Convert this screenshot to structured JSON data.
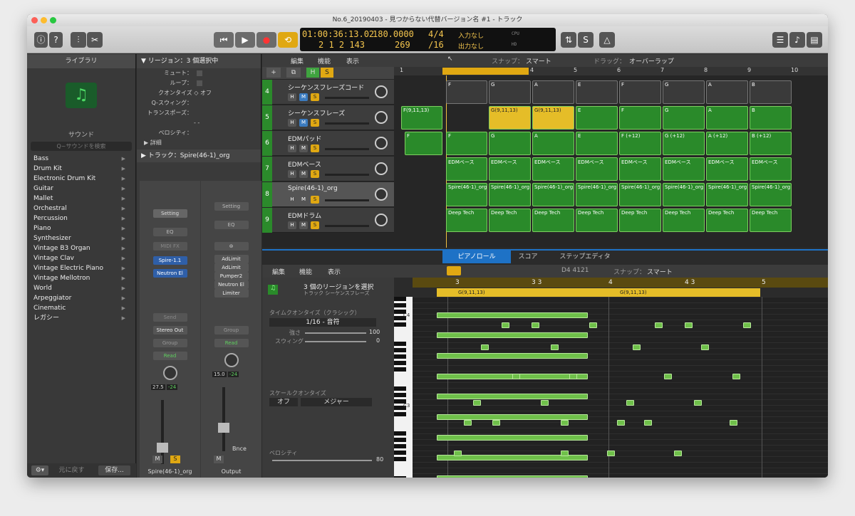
{
  "window": {
    "title": "No.6_20190403 - 見つからない代替バージョン名 #1 - トラック"
  },
  "lcd": {
    "time": "01:00:36:13.02",
    "bars": "2 1 2 143",
    "tempo": "180.0000",
    "tempo2": "269",
    "sig": "4/4",
    "div": "/16",
    "in": "入力なし",
    "out": "出力なし",
    "cpu": "CPU",
    "hd": "HD"
  },
  "library": {
    "header": "ライブラリ",
    "sound_label": "サウンド",
    "search_placeholder": "Q~サウンドを検索",
    "items": [
      "Bass",
      "Drum Kit",
      "Electronic Drum Kit",
      "Guitar",
      "Mallet",
      "Orchestral",
      "Percussion",
      "Piano",
      "Synthesizer",
      "Vintage B3 Organ",
      "Vintage Clav",
      "Vintage Electric Piano",
      "Vintage Mellotron",
      "World",
      "Arpeggiator",
      "Cinematic",
      "レガシー"
    ],
    "revert": "元に戻す",
    "save": "保存..."
  },
  "inspector": {
    "region_header": "▼ リージョン：3 個選択中",
    "mute": "ミュート：",
    "loop": "ループ：",
    "quantize": "クオンタイズ ◇ オフ",
    "qswing": "Q-スウィング：",
    "transpose": "トランスポーズ：",
    "velocity": "ベロシティ：",
    "dash": "- -",
    "detail": "▶ 詳細",
    "track_header": "▶ トラック：Spire(46-1)_org"
  },
  "strip1": {
    "setting": "Setting",
    "eq": "EQ",
    "midifx": "MIDI FX",
    "inst": "Spire-1.1",
    "fx1": "Neutron El",
    "send": "Send",
    "stereo": "Stereo Out",
    "group": "Group",
    "read": "Read",
    "val1": "27.5",
    "val2": "-24",
    "m": "M",
    "s": "S",
    "name": "Spire(46-1)_org"
  },
  "strip2": {
    "setting": "Setting",
    "eq": "EQ",
    "fx": [
      "AdLimit",
      "AdLimit",
      "Pumper2",
      "Neutron El",
      "Limiter"
    ],
    "group": "Group",
    "read": "Read",
    "val1": "15.0",
    "val2": "-24",
    "bnce": "Bnce",
    "m": "M",
    "name": "Output"
  },
  "tracks_toolbar": {
    "edit": "編集",
    "func": "機能",
    "view": "表示",
    "snap_label": "スナップ：",
    "snap": "スマート",
    "drag_label": "ドラッグ：",
    "drag": "オーバーラップ"
  },
  "ruler": [
    "1",
    "2",
    "3",
    "4",
    "5",
    "6",
    "7",
    "8",
    "9",
    "10"
  ],
  "tracks": [
    {
      "num": "4",
      "name": "シーケンスフレーズコード"
    },
    {
      "num": "5",
      "name": "シーケンスフレーズ"
    },
    {
      "num": "6",
      "name": "EDMパッド"
    },
    {
      "num": "7",
      "name": "EDMベース"
    },
    {
      "num": "8",
      "name": "Spire(46-1)_org"
    },
    {
      "num": "9",
      "name": "EDMドラム"
    }
  ],
  "regions": [
    [
      "F",
      "G",
      "A",
      "E",
      "F",
      "G",
      "A",
      "B"
    ],
    [
      "F(9,11,13)",
      "G(9,11,13)",
      "G(9,11,13)",
      "E",
      "F",
      "G",
      "A",
      "B"
    ],
    [
      "F",
      "F",
      "G",
      "A",
      "E",
      "F (+12)",
      "G (+12)",
      "A (+12)",
      "B (+12)"
    ],
    [
      "EDMベース",
      "EDMベース",
      "EDMベース",
      "EDMベース",
      "EDMベース",
      "EDMベース",
      "EDMベース",
      "EDMベース"
    ],
    [
      "Spire(46-1)_org",
      "Spire(46-1)_org",
      "Spire(46-1)_org",
      "Spire(46-1)_org",
      "Spire(46-1)_org",
      "Spire(46-1)_org",
      "Spire(46-1)_org",
      "Spire(46-1)_org"
    ],
    [
      "Deep Tech",
      "Deep Tech",
      "Deep Tech",
      "Deep Tech",
      "Deep Tech",
      "Deep Tech",
      "Deep Tech",
      "Deep Tech"
    ]
  ],
  "editor": {
    "tabs": [
      "ピアノロール",
      "スコア",
      "ステップエディタ"
    ],
    "edit": "編集",
    "func": "機能",
    "view": "表示",
    "pos": "D4 4121",
    "snap_label": "スナップ：",
    "snap": "スマート",
    "sel_title": "3 個のリージョンを選択",
    "sel_sub": "トラック シーケンスフレーズ",
    "tq": "タイムクオンタイズ（クラシック）",
    "tq_val": "1/16 - 音符",
    "str": "強さ",
    "str_val": "100",
    "swing": "スウィング",
    "swing_val": "0",
    "sq": "スケールクオンタイズ",
    "sq_off": "オフ",
    "sq_scale": "メジャー",
    "vel": "ベロシティ",
    "vel_val": "80",
    "ruler": [
      "3",
      "3 3",
      "4",
      "4 3",
      "5"
    ],
    "reg1": "G(9,11,13)",
    "reg2": "G(9,11,13)",
    "c4": "C4",
    "c3": "C3"
  }
}
